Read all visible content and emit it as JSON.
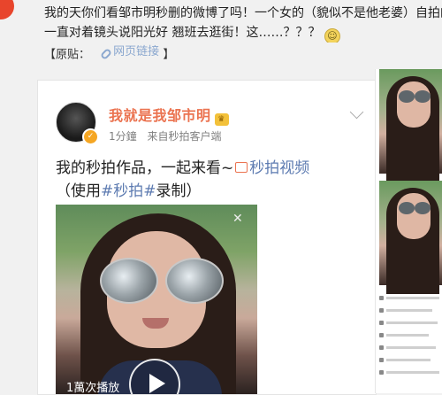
{
  "post": {
    "line1": "我的天你们看邹市明秒删的微博了吗！一个女的（貌似不是他老婆）自拍的",
    "line2": "一直对着镜头说阳光好  翘班去逛街！这……？？？",
    "source_label": "【原贴：",
    "link_text": "网页链接",
    "source_end": "】"
  },
  "repost": {
    "author": "我就是我邹市明",
    "time": "1分鐘",
    "client": "来自秒拍客户端",
    "text_prefix": "我的秒拍作品，一起来看~",
    "video_link": "秒拍视频",
    "text_paren_open": "（使用",
    "hashtag": "#秒拍#",
    "text_paren_close": "录制）",
    "play_count": "1萬次播放"
  },
  "icons": {
    "link": "link-icon",
    "verified": "verified-badge-icon",
    "crown": "crown-badge-icon",
    "video": "video-icon",
    "play": "play-icon",
    "chevron": "chevron-down-icon"
  },
  "colors": {
    "author": "#eb7350",
    "link": "#5d7bb1",
    "meta": "#808080"
  }
}
